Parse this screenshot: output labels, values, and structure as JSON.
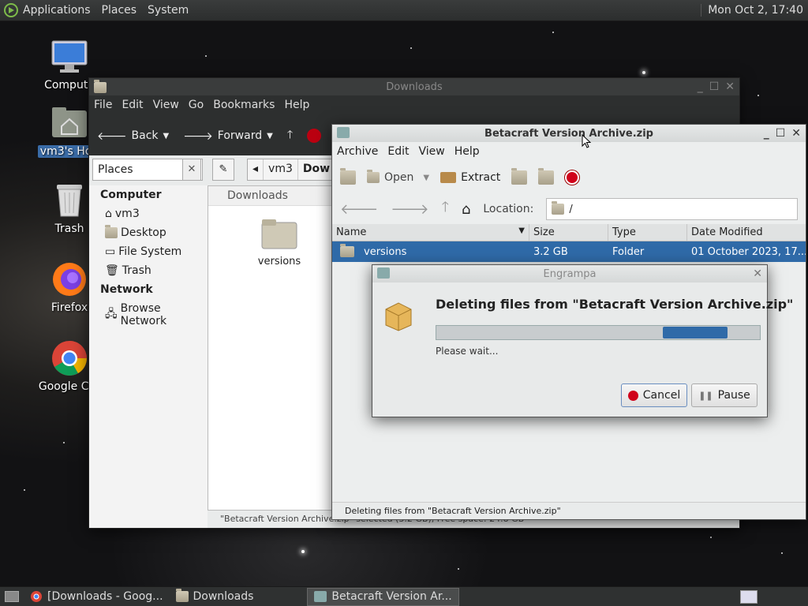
{
  "top_panel": {
    "menus": [
      "Applications",
      "Places",
      "System"
    ],
    "clock": "Mon Oct 2, 17:40"
  },
  "desktop": {
    "icons": [
      {
        "label": "Compute",
        "icon": "computer-icon"
      },
      {
        "label": "vm3's Hon",
        "icon": "home-folder-icon"
      },
      {
        "label": "Trash",
        "icon": "trash-icon"
      },
      {
        "label": "Firefox",
        "icon": "firefox-icon"
      },
      {
        "label": "Google Chr",
        "icon": "chrome-icon"
      }
    ]
  },
  "file_manager": {
    "title": "Downloads",
    "menu": [
      "File",
      "Edit",
      "View",
      "Go",
      "Bookmarks",
      "Help"
    ],
    "toolbar": {
      "back": "Back",
      "forward": "Forward"
    },
    "places_label": "Places",
    "path": [
      "vm3",
      "Dow"
    ],
    "sidebar": {
      "computer_header": "Computer",
      "computer_items": [
        "vm3",
        "Desktop",
        "File System",
        "Trash"
      ],
      "network_header": "Network",
      "network_items": [
        "Browse Network"
      ]
    },
    "location_header": "Downloads",
    "folder_name": "versions",
    "status": "\"Betacraft Version Archive.zip\" selected (3.2 GB), Free space: 24.8 GB"
  },
  "archive_manager": {
    "title": "Betacraft Version Archive.zip",
    "menu": [
      "Archive",
      "Edit",
      "View",
      "Help"
    ],
    "toolbar": {
      "open": "Open",
      "extract": "Extract"
    },
    "location_label": "Location:",
    "location_value": "/",
    "columns": [
      "Name",
      "Size",
      "Type",
      "Date Modified"
    ],
    "rows": [
      {
        "name": "versions",
        "size": "3.2 GB",
        "type": "Folder",
        "date": "01 October 2023, 17..."
      }
    ],
    "status": "Deleting files from \"Betacraft Version Archive.zip\""
  },
  "dialog": {
    "title": "Engrampa",
    "heading": "Deleting files from \"Betacraft Version Archive.zip\"",
    "progress_start": 0.7,
    "progress_end": 0.9,
    "message": "Please wait...",
    "cancel": "Cancel",
    "pause": "Pause"
  },
  "taskbar": {
    "tasks": [
      "[Downloads - Goog...",
      "Downloads",
      "Betacraft Version Ar..."
    ]
  },
  "colors": {
    "accent": "#2f6aa8",
    "stop": "#d0021b"
  }
}
